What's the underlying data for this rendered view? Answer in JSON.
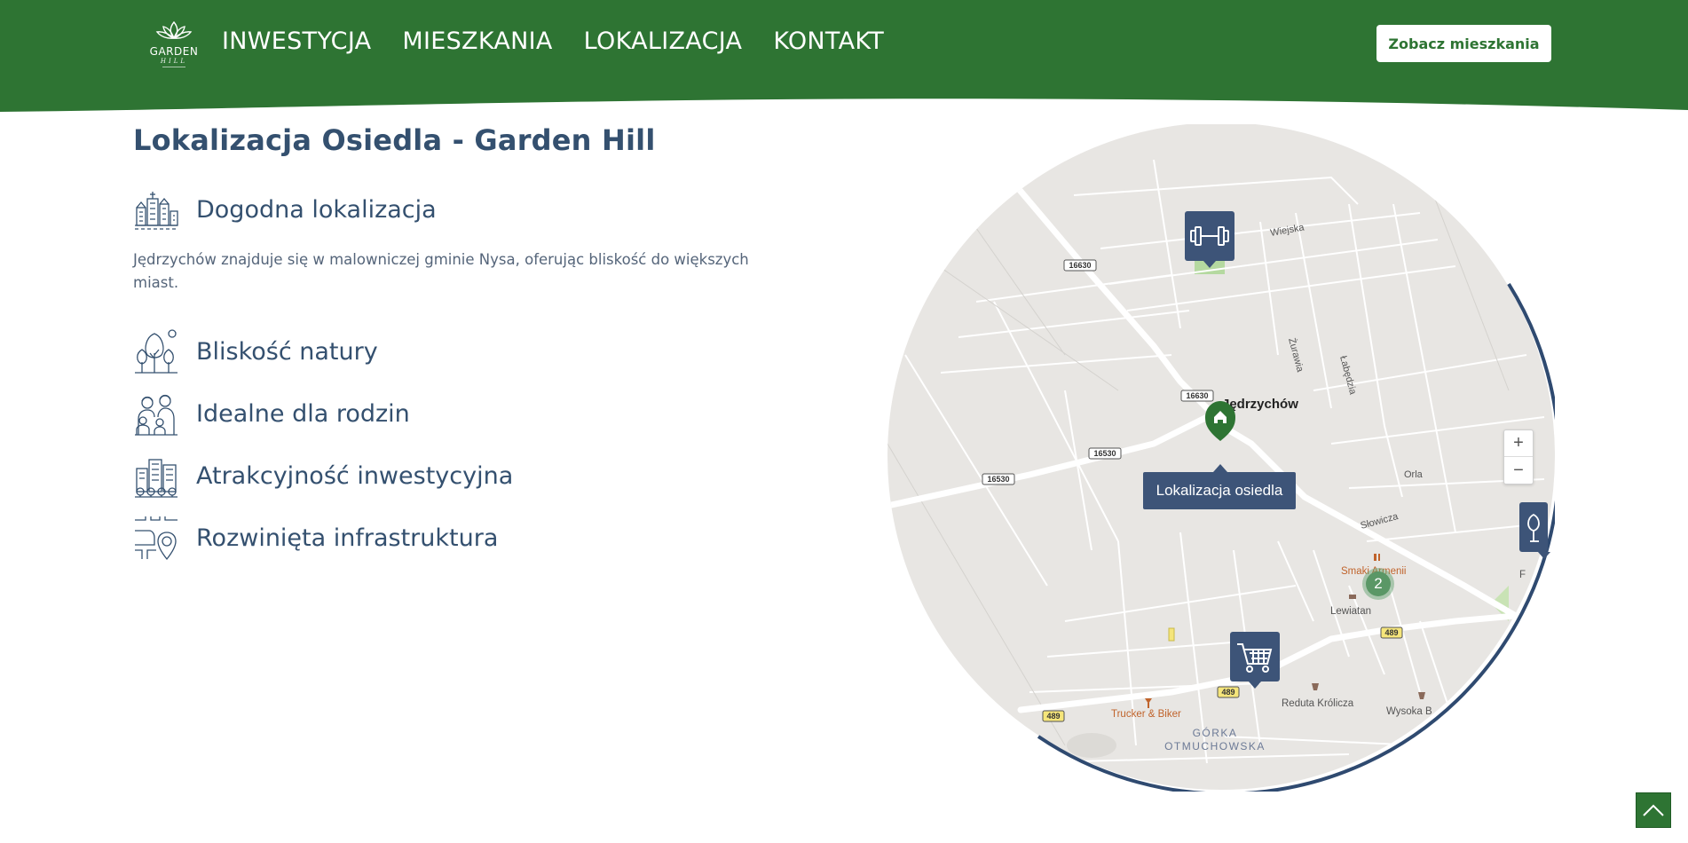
{
  "header": {
    "logo": {
      "name": "GARDEN",
      "sub": "HILL"
    },
    "nav": [
      "INWESTYCJA",
      "MIESZKANIA",
      "LOKALIZACJA",
      "KONTAKT"
    ],
    "cta_label": "Zobacz mieszkania",
    "colors": {
      "green": "#2e7433",
      "white": "#ffffff"
    }
  },
  "main": {
    "title": "Lokalizacja Osiedla - Garden Hill",
    "features": [
      {
        "icon": "city-icon",
        "label": "Dogodna lokalizacja"
      },
      {
        "icon": "trees-icon",
        "label": "Bliskość natury"
      },
      {
        "icon": "family-icon",
        "label": "Idealne dla rodzin"
      },
      {
        "icon": "buildings-icon",
        "label": "Atrakcyjność inwestycyjna"
      },
      {
        "icon": "route-pin-icon",
        "label": "Rozwinięta infrastruktura"
      }
    ],
    "description": "Jędrzychów znajduje się w malowniczej gminie Nysa, oferując bliskość do większych miast."
  },
  "map": {
    "tooltip": "Lokalizacja osiedla",
    "zoom_in": "+",
    "zoom_out": "−",
    "cluster_count": "2",
    "place_labels": {
      "village": "Jędrzychów",
      "gorka1": "GÓRKA",
      "gorka2": "OTMUCHOWSKA",
      "smaki": "Smaki Armenii",
      "lewiatan": "Lewiatan",
      "reduta": "Reduta Królicza",
      "trucker": "Trucker & Biker",
      "wysoka": "Wysoka B",
      "fr": "F"
    },
    "street_labels": {
      "wiejska": "Wiejska",
      "zurawia": "Żurawia",
      "labedzia": "Łabędzia",
      "orla": "Orla",
      "slowicza": "Słowicza"
    },
    "road_numbers": {
      "r16630a": "16630",
      "r16630b": "16630",
      "r16530a": "16530",
      "r16530b": "16530",
      "r489a": "489",
      "r489b": "489",
      "r489c": "489"
    },
    "marker_icons": [
      "gym-icon",
      "home-pin-icon",
      "cart-icon",
      "tree-icon"
    ],
    "colors": {
      "marker": "#3d5478",
      "pin": "#2e7433",
      "land": "#e8e6e3",
      "border": "#2f4a70"
    }
  },
  "scroll_top_icon": "chevron-up-icon"
}
